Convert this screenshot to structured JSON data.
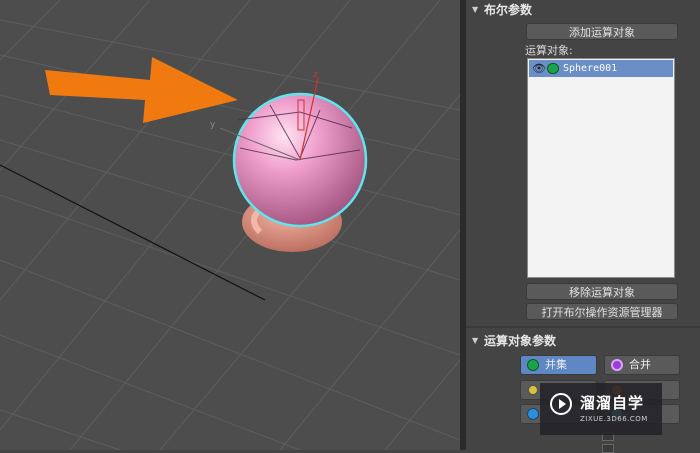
{
  "viewport": {
    "axis_z": "z",
    "axis_y": "y"
  },
  "boolean_rollout": {
    "title": "布尔参数",
    "add_operand_button": "添加运算对象",
    "operands_label": "运算对象:",
    "operands": [
      {
        "name": "Sphere001",
        "visible_icon": "eye-icon"
      }
    ],
    "remove_operand_button": "移除运算对象",
    "open_explorer_button": "打开布尔操作资源管理器"
  },
  "operand_params_rollout": {
    "title": "运算对象参数",
    "operations": [
      {
        "label": "并集",
        "selected": true,
        "color": "#1aa44a"
      },
      {
        "label": "合并",
        "selected": false,
        "color": "#9b3cd6"
      }
    ]
  },
  "watermark": {
    "title": "溜溜自学",
    "subtitle": "ZIXUE.3D66.COM"
  },
  "colors": {
    "viewport_bg": "#4d4d4d",
    "panel_bg": "#444444",
    "sphere": "#e79bc8",
    "selection_outline": "#5fe6ec",
    "arrow": "#f07a10",
    "selected_button": "#5f87c4"
  }
}
